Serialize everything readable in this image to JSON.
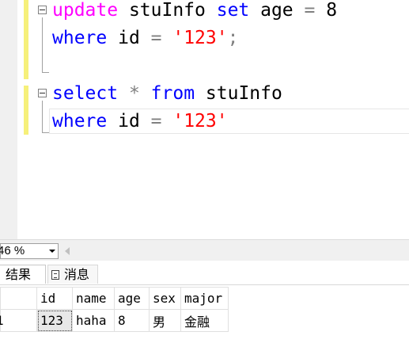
{
  "editor": {
    "lines": [
      {
        "tokens": [
          {
            "text": "update",
            "class": "fn"
          },
          {
            "text": " stuInfo ",
            "class": "plain"
          },
          {
            "text": "set",
            "class": "kw"
          },
          {
            "text": " age ",
            "class": "plain"
          },
          {
            "text": "=",
            "class": "op"
          },
          {
            "text": " 8",
            "class": "plain"
          }
        ]
      },
      {
        "tokens": [
          {
            "text": "where",
            "class": "kw"
          },
          {
            "text": " id ",
            "class": "plain"
          },
          {
            "text": "=",
            "class": "op"
          },
          {
            "text": " ",
            "class": "plain"
          },
          {
            "text": "'123'",
            "class": "str"
          },
          {
            "text": ";",
            "class": "op"
          }
        ]
      },
      {
        "tokens": [
          {
            "text": "select",
            "class": "kw"
          },
          {
            "text": " ",
            "class": "plain"
          },
          {
            "text": "*",
            "class": "op"
          },
          {
            "text": " ",
            "class": "plain"
          },
          {
            "text": "from",
            "class": "kw"
          },
          {
            "text": " stuInfo",
            "class": "plain"
          }
        ]
      },
      {
        "tokens": [
          {
            "text": "where",
            "class": "kw"
          },
          {
            "text": " id ",
            "class": "plain"
          },
          {
            "text": "=",
            "class": "op"
          },
          {
            "text": " ",
            "class": "plain"
          },
          {
            "text": "'123'",
            "class": "str"
          }
        ]
      }
    ]
  },
  "zoom": {
    "value": "46 %"
  },
  "tabs": {
    "results_label": "结果",
    "messages_label": "消息"
  },
  "results": {
    "columns": [
      "id",
      "name",
      "age",
      "sex",
      "major"
    ],
    "rows": [
      {
        "rownum": "1",
        "cells": [
          "123",
          "haha",
          "8",
          "男",
          "金融"
        ]
      }
    ]
  },
  "colors": {
    "keyword": "#0000ff",
    "function": "#ff00ff",
    "string": "#ff0000",
    "operator": "#808080",
    "change_bar": "#f6f07a"
  },
  "icons": [
    "collapse-icon",
    "dropdown-arrow-icon",
    "scroll-left-icon",
    "grid-icon",
    "messages-icon"
  ]
}
